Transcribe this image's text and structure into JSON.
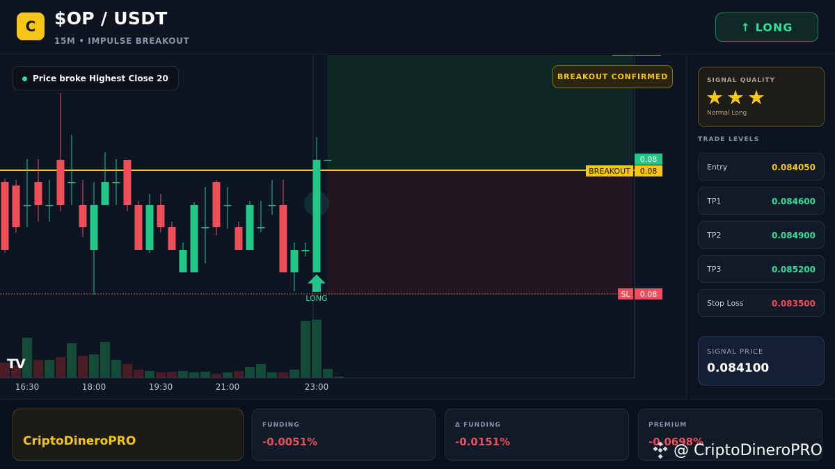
{
  "header": {
    "logo_letter": "C",
    "pair": "$OP / USDT",
    "subtitle": "15M • IMPULSE BREAKOUT",
    "direction_button": "↑ LONG"
  },
  "chart": {
    "note": "Price broke Highest Close 20",
    "confirm_badge": "BREAKOUT CONFIRMED",
    "tags": {
      "top": "0.08",
      "breakout_label": "BREAKOUT",
      "breakout_value": "0.08",
      "sl_label": "SL",
      "sl_value": "0.08"
    },
    "signal_marker": "LONG",
    "watermark_logo": "TV",
    "x_labels": [
      "16:30",
      "18:00",
      "19:30",
      "21:00",
      "23:00"
    ]
  },
  "sidebar": {
    "quality_title": "SIGNAL QUALITY",
    "stars": "★★★",
    "star_rating": 3,
    "quality_sub": "Normal Long",
    "levels_title": "TRADE LEVELS",
    "levels": [
      {
        "label": "Entry",
        "value": "0.084050",
        "color": "#f5c518"
      },
      {
        "label": "TP1",
        "value": "0.084600",
        "color": "#2fe09a"
      },
      {
        "label": "TP2",
        "value": "0.084900",
        "color": "#2fe09a"
      },
      {
        "label": "TP3",
        "value": "0.085200",
        "color": "#2fe09a"
      },
      {
        "label": "Stop Loss",
        "value": "0.083500",
        "color": "#ef4d5c"
      }
    ],
    "signal_price_label": "SIGNAL PRICE",
    "signal_price": "0.084100"
  },
  "footer": {
    "brand": "CriptoDineroPRO",
    "stats": [
      {
        "label": "FUNDING",
        "value": "-0.0051%"
      },
      {
        "label": "Δ FUNDING",
        "value": "-0.0151%"
      },
      {
        "label": "PREMIUM",
        "value": "-0.0698%"
      }
    ],
    "watermark": "@ CriptoDineroPRO"
  },
  "colors": {
    "up": "#22c58a",
    "down": "#ef4d5c",
    "accent": "#f5c518"
  }
}
